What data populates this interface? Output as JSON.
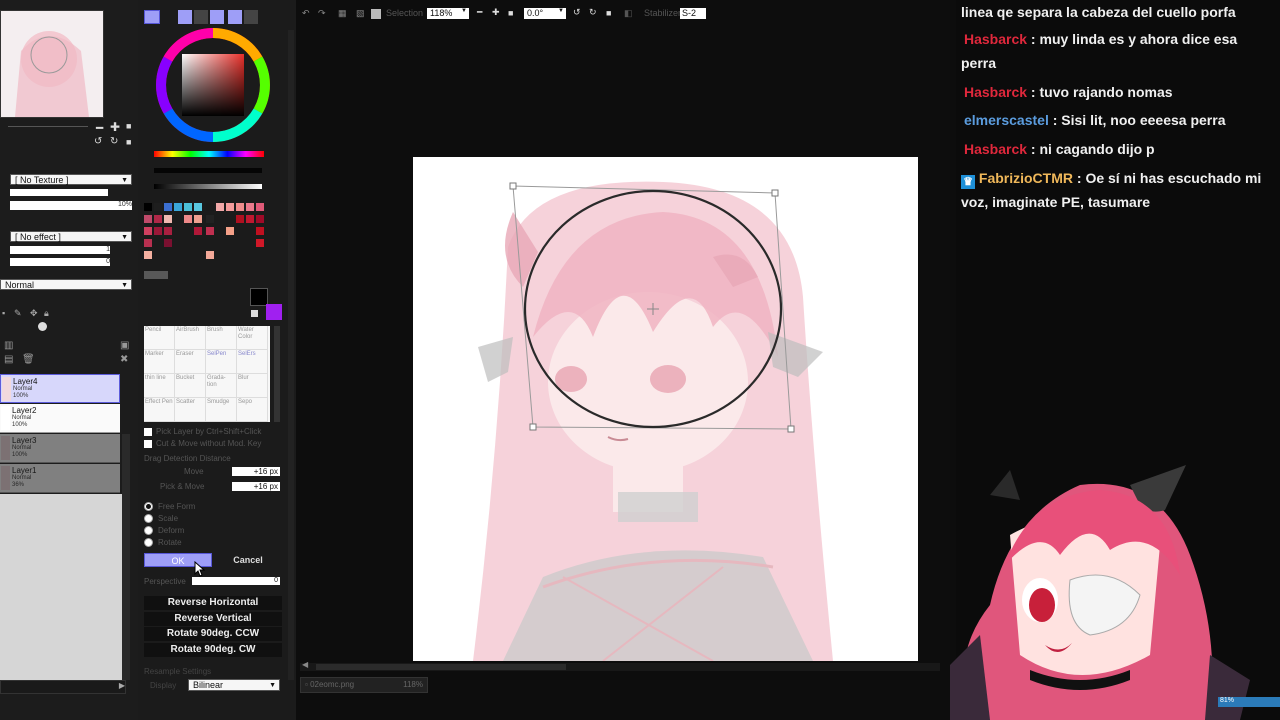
{
  "left_panel": {
    "texture_select": "[ No Texture ]",
    "texture_value": "10%",
    "effect_select": "[ No effect ]",
    "effect_value1": "1",
    "effect_value2": "0",
    "blend_select": "Normal",
    "layers": [
      {
        "name": "Layer4",
        "mode": "Normal",
        "opacity": "100%",
        "selected": true
      },
      {
        "name": "Layer2",
        "mode": "Normal",
        "opacity": "100%",
        "selected": false
      },
      {
        "name": "Layer3",
        "mode": "Normal",
        "opacity": "100%",
        "selected": false
      },
      {
        "name": "Layer1",
        "mode": "Normal",
        "opacity": "36%",
        "selected": false
      }
    ]
  },
  "tool_panel": {
    "tools": [
      "Pencil",
      "AirBrush",
      "Brush",
      "Water Color",
      "Marker",
      "Eraser",
      "SelPen",
      "SelErs",
      "thin line",
      "Bucket",
      "Grada-tion",
      "Blur",
      "Effect Pen",
      "Scatter",
      "Smudge",
      "Sepo"
    ],
    "checkbox1": "Pick Layer by Ctrl+Shift+Click",
    "checkbox2": "Cut & Move without Mod. Key",
    "drag_label": "Drag Detection Distance",
    "move_label": "Move",
    "move_value": "+16 px",
    "pick_move_label": "Pick & Move",
    "pick_move_value": "+16 px",
    "transform_modes": [
      "Free Form",
      "Scale",
      "Deform",
      "Rotate"
    ],
    "ok_label": "OK",
    "cancel_label": "Cancel",
    "perspective_label": "Perspective",
    "perspective_value": "0",
    "reverse_horizontal": "Reverse Horizontal",
    "reverse_vertical": "Reverse Vertical",
    "rotate_ccw": "Rotate 90deg. CCW",
    "rotate_cw": "Rotate 90deg. CW",
    "resample_label": "Resample Settings",
    "display_label": "Display",
    "interp_select": "Bilinear"
  },
  "toolbar": {
    "selection_label": "Selection",
    "zoom": "118%",
    "angle": "0.0°",
    "stabilizer_label": "Stabilizer",
    "stabilizer_value": "S-2"
  },
  "status": {
    "file_name": "02eomc.png",
    "file_zoom": "118%",
    "percent": "81%"
  },
  "colors": {
    "accent": "#7b2fff",
    "selected_layer": "#d7d7fb",
    "primary_swatch": "#000000",
    "secondary_swatch": "#a020f0"
  },
  "chat": [
    {
      "user": "",
      "user_color": "#ffffff",
      "text": "linea qe separa la cabeza del cuello porfa",
      "badge": false
    },
    {
      "user": "Hasbarck",
      "user_color": "#e0283c",
      "text": "muy linda es y ahora dice esa perra",
      "badge": false
    },
    {
      "user": "Hasbarck",
      "user_color": "#e0283c",
      "text": "tuvo rajando nomas",
      "badge": false
    },
    {
      "user": "elmerscastel",
      "user_color": "#5b9cde",
      "text": "Sisi lit, noo eeeesa perra",
      "badge": false
    },
    {
      "user": "Hasbarck",
      "user_color": "#e0283c",
      "text": "ni cagando dijo p",
      "badge": false
    },
    {
      "user": "FabrizioCTMR",
      "user_color": "#f0b85a",
      "text": "Oe sí ni has escuchado mi voz, imaginate PE, tasumare",
      "badge": true
    }
  ]
}
